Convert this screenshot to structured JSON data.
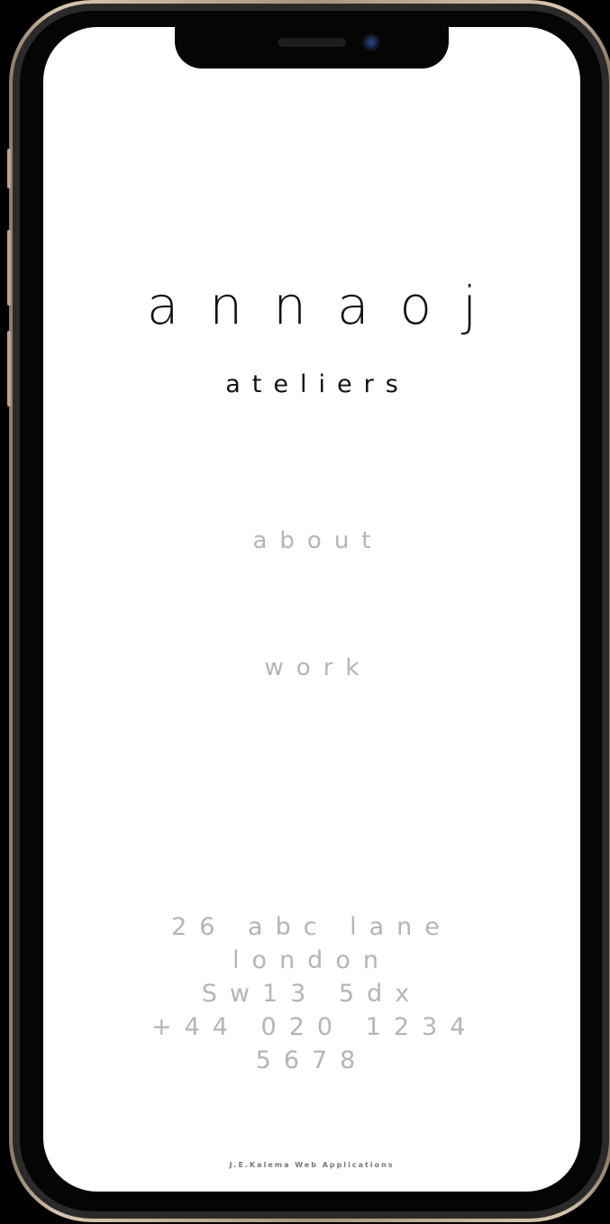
{
  "brand": {
    "title": "annaoj",
    "subtitle": "ateliers"
  },
  "nav": {
    "about": "about",
    "work": "work"
  },
  "address": {
    "line1": "26 abc lane",
    "line2": "london",
    "line3": "Sw13 5dx",
    "line4": "+44 020 1234",
    "line5": "5678"
  },
  "footer": {
    "credit": "J.E.Kalema Web Applications"
  },
  "colors": {
    "background": "#ffffff",
    "title_text": "#111111",
    "muted_text": "#b5b5b5",
    "device_frame": "#050505",
    "device_rim": "#d9c6ad"
  }
}
